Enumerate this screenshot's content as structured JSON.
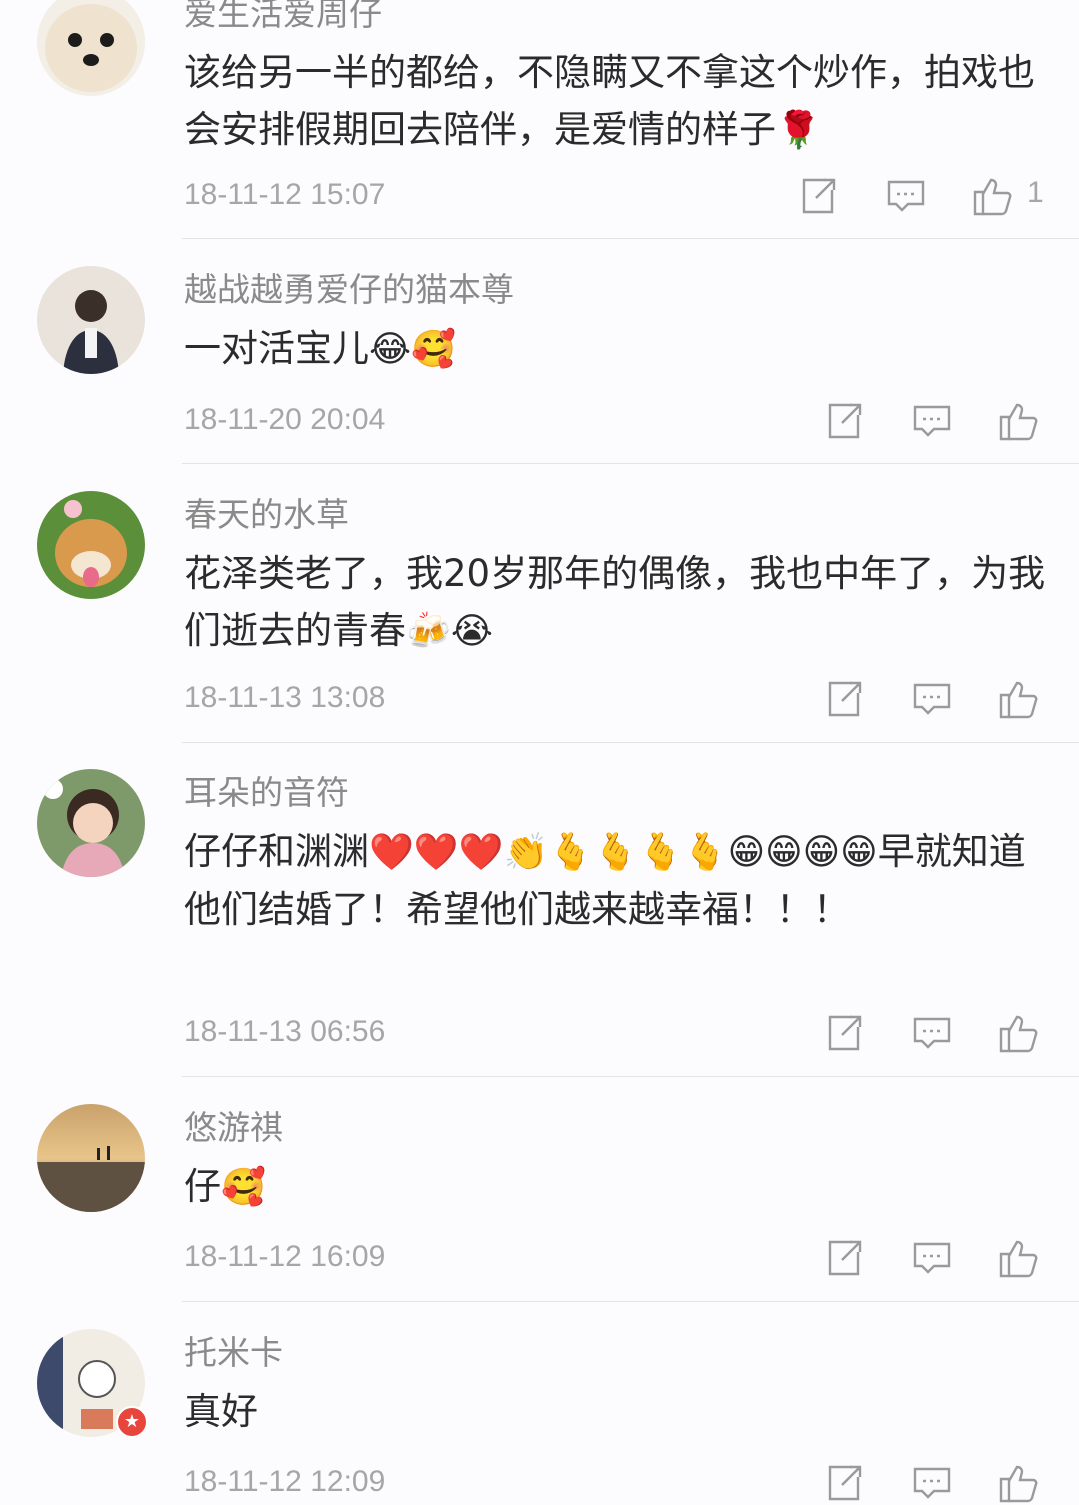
{
  "comments": [
    {
      "username": "爱生活爱周仔",
      "text": "该给另一半的都给，不隐瞒又不拿这个炒作，拍戏也会安排假期回去陪伴，是爱情的样子",
      "emoji": "🌹",
      "time": "18-11-12 15:07",
      "likes": "1"
    },
    {
      "username": "越战越勇爱仔的猫本尊",
      "text": "一对活宝儿",
      "emoji": "😂🥰",
      "time": "18-11-20 20:04",
      "likes": ""
    },
    {
      "username": "春天的水草",
      "text": "花泽类老了，我20岁那年的偶像，我也中年了，为我们逝去的青春",
      "emoji": "🍻😭",
      "time": "18-11-13 13:08",
      "likes": ""
    },
    {
      "username": "耳朵的音符",
      "text_a": "仔仔和渊渊",
      "emoji_a": "❤️❤️❤️👏🫰🫰🫰🫰😁😁😁😁",
      "text_b": "早就知道他们结婚了！希望他们越来越幸福！！！",
      "time": "18-11-13 06:56",
      "likes": ""
    },
    {
      "username": "悠游祺",
      "text": "仔",
      "emoji": "🥰",
      "time": "18-11-12 16:09",
      "likes": ""
    },
    {
      "username": "托米卡",
      "text": "真好",
      "emoji": "",
      "time": "18-11-12 12:09",
      "likes": ""
    }
  ],
  "icons": {
    "repost": "repost-icon",
    "comment": "comment-icon",
    "like": "thumbs-up-icon"
  },
  "colors": {
    "username": "#8a8a8a",
    "time": "#a6a6a6",
    "badge": "#e8453c"
  }
}
